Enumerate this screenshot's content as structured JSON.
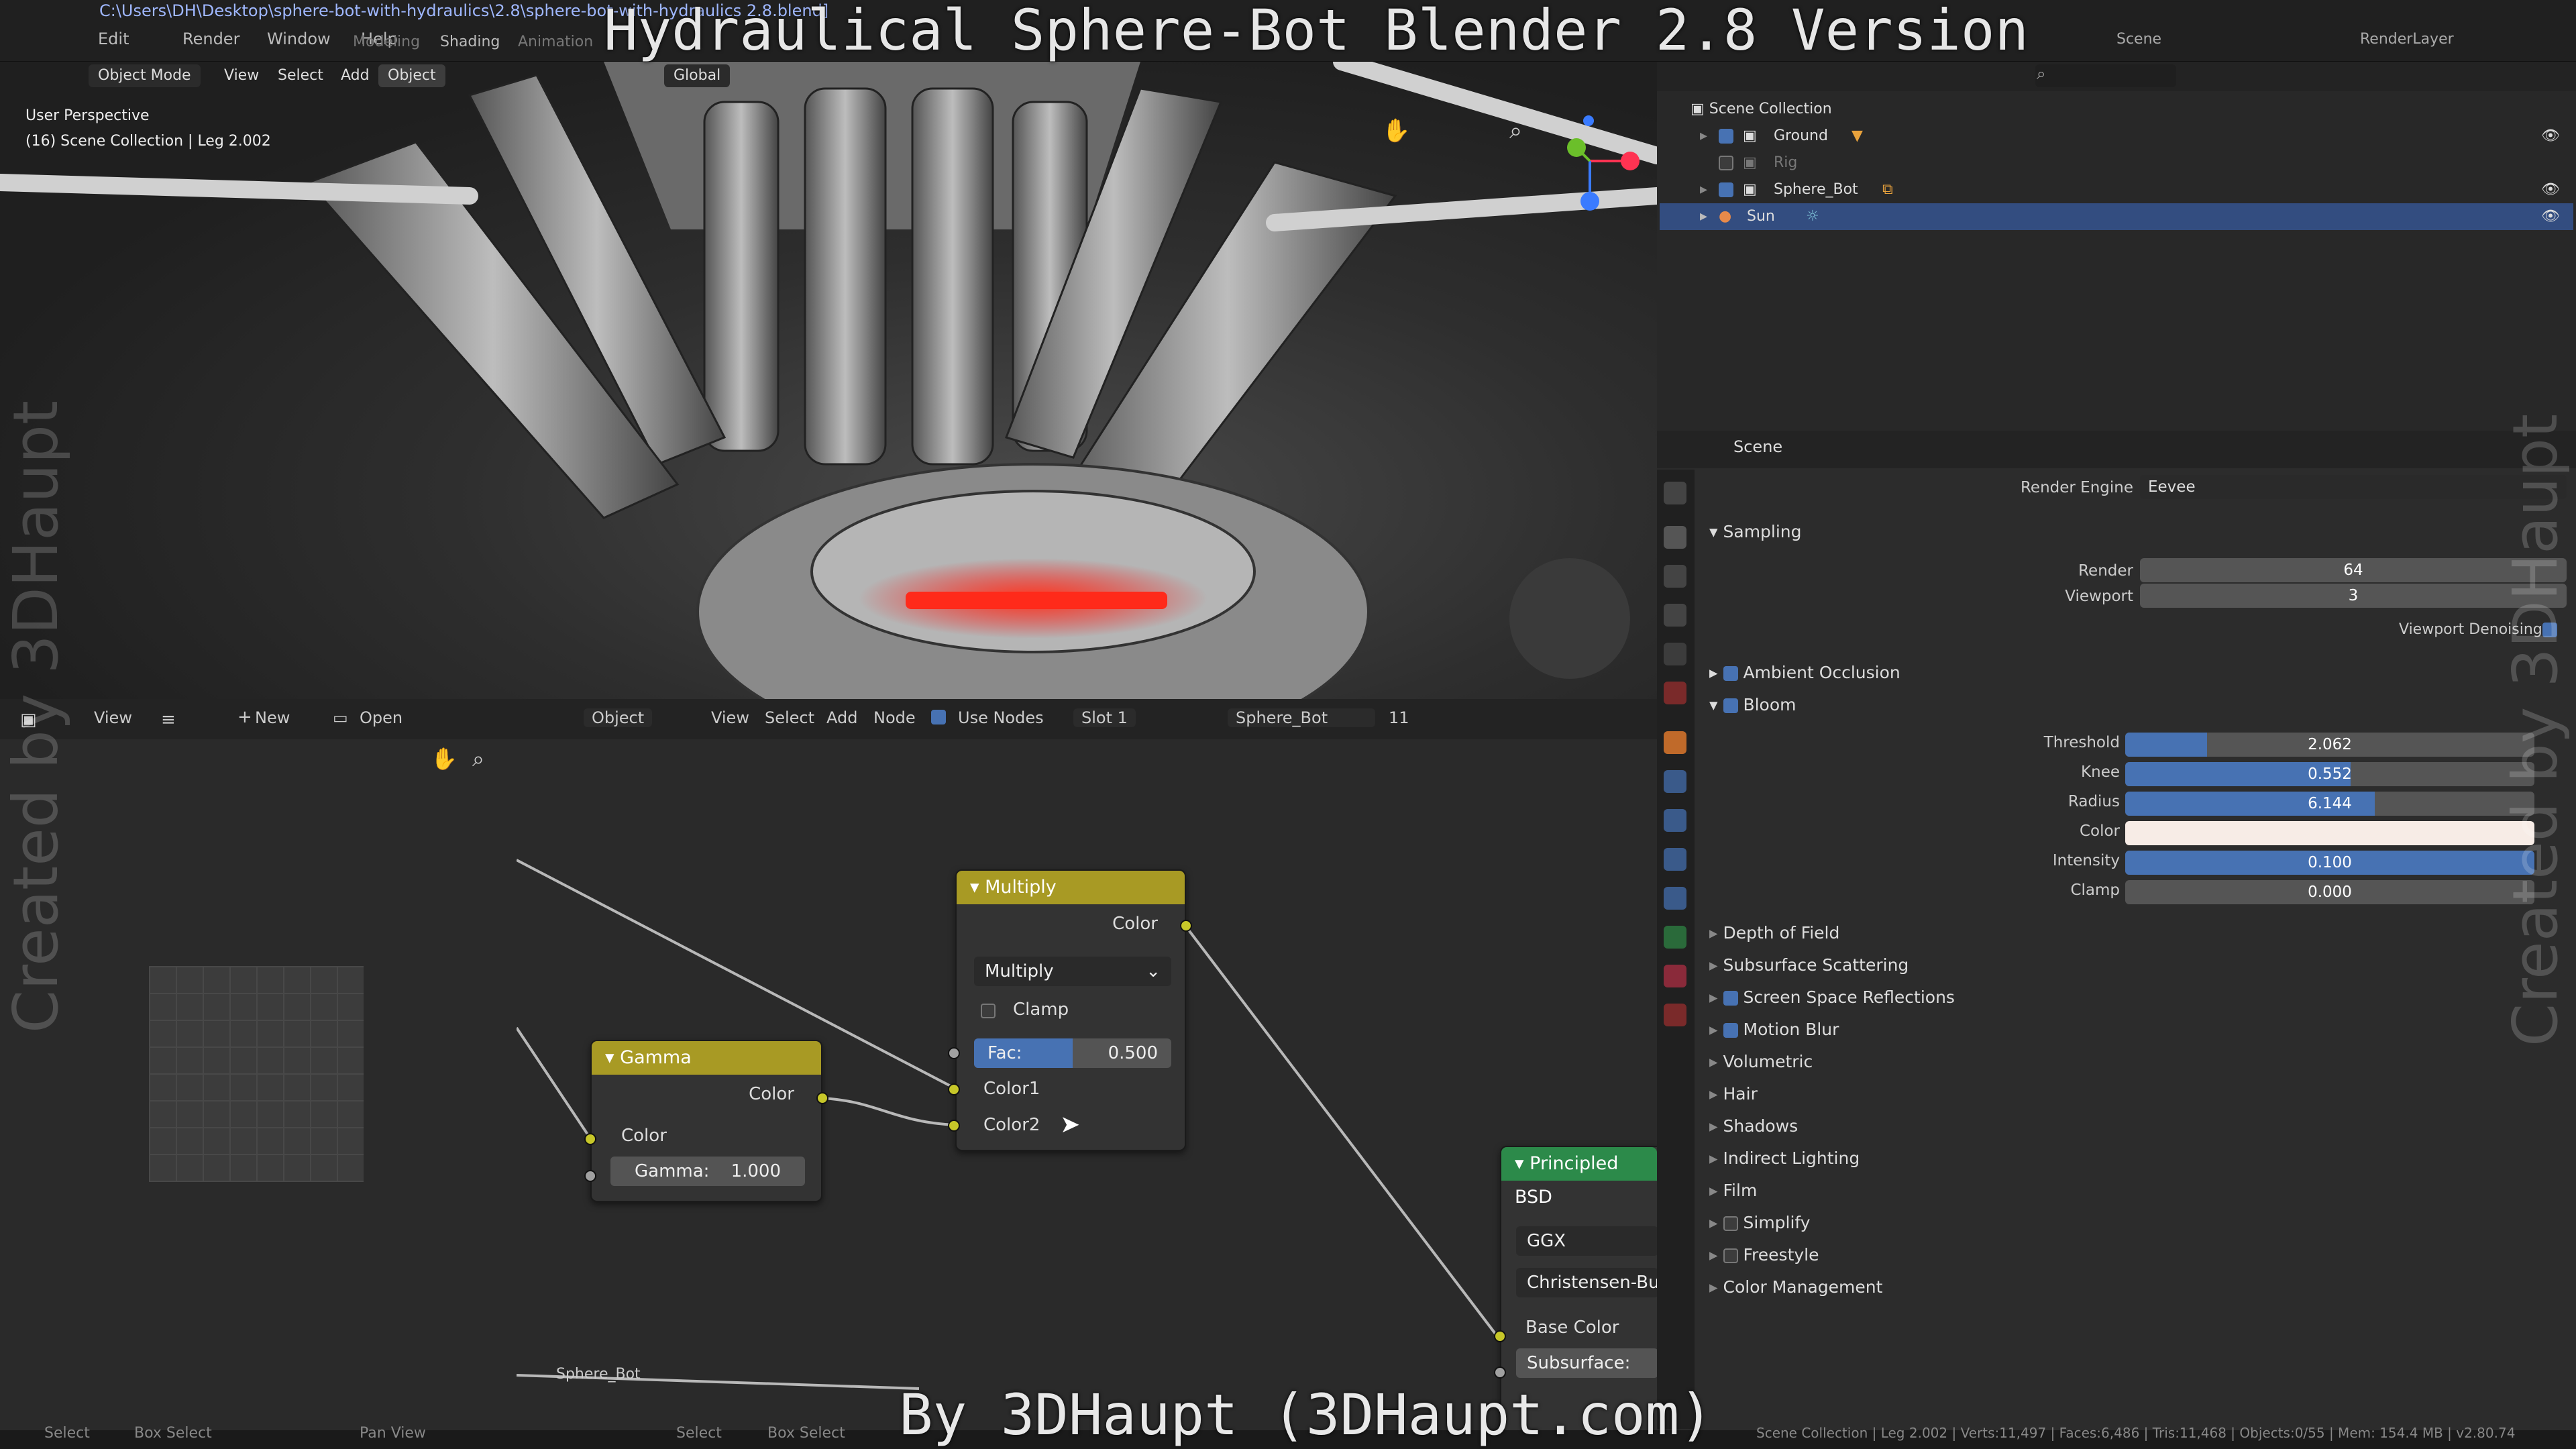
{
  "app": {
    "file_path": "C:\\Users\\DH\\Desktop\\sphere-bot-with-hydraulics\\2.8\\sphere-bot-with-hydraulics 2.8.blend]",
    "menus": [
      "Edit",
      "Render",
      "Window",
      "Help"
    ],
    "workspaces": [
      "Modeling",
      "Shading",
      "Animation"
    ],
    "scene": "Scene",
    "render_layer": "RenderLayer"
  },
  "overlay": {
    "title": "Hydraulical Sphere-Bot Blender 2.8 Version",
    "credit": "By 3DHaupt (3DHaupt.com)",
    "watermark_left": "Created by 3DHaupt",
    "watermark_right": "Created by 3DHaupt"
  },
  "viewport": {
    "mode": "Object Mode",
    "menus": [
      "View",
      "Select",
      "Add",
      "Object"
    ],
    "transform": "Global",
    "info_line1": "User Perspective",
    "info_line2": "(16) Scene Collection | Leg 2.002"
  },
  "image_editor": {
    "view": "View",
    "new": "New",
    "open": "Open"
  },
  "node_editor": {
    "object": "Object",
    "menus": [
      "View",
      "Select",
      "Add",
      "Node"
    ],
    "use_nodes": "Use Nodes",
    "slot": "Slot 1",
    "material": "Sphere_Bot",
    "users": "11",
    "material_label": "Sphere_Bot",
    "multiply": {
      "title": "Multiply",
      "output": "Color",
      "mode": "Multiply",
      "clamp": "Clamp",
      "fac_label": "Fac:",
      "fac_value": "0.500",
      "fac": 0.5,
      "input1": "Color1",
      "input2": "Color2"
    },
    "gamma": {
      "title": "Gamma",
      "output": "Color",
      "input": "Color",
      "gamma_label": "Gamma:",
      "gamma_value": "1.000"
    },
    "principled": {
      "title": "Principled BSD",
      "distribution": "GGX",
      "subsurface_method": "Christensen-Bur",
      "base_color": "Base Color",
      "subsurface": "Subsurface:"
    }
  },
  "outliner": {
    "root": "Scene Collection",
    "items": [
      {
        "name": "Ground",
        "checked": true
      },
      {
        "name": "Rig",
        "checked": false
      },
      {
        "name": "Sphere_Bot",
        "checked": true
      },
      {
        "name": "Sun",
        "checked": true
      }
    ]
  },
  "properties": {
    "context": "Scene",
    "render_engine_label": "Render Engine",
    "render_engine": "Eevee",
    "sampling": {
      "title": "Sampling",
      "render_label": "Render",
      "render": "64",
      "viewport_label": "Viewport",
      "viewport": "3",
      "denoise": "Viewport Denoising"
    },
    "ambient_occlusion": "Ambient Occlusion",
    "bloom": {
      "title": "Bloom",
      "threshold_label": "Threshold",
      "threshold": "2.062",
      "threshold_fill": 0.2,
      "knee_label": "Knee",
      "knee": "0.552",
      "knee_fill": 0.55,
      "radius_label": "Radius",
      "radius": "6.144",
      "radius_fill": 0.61,
      "color_label": "Color",
      "intensity_label": "Intensity",
      "intensity": "0.100",
      "intensity_fill": 1.0,
      "clamp_label": "Clamp",
      "clamp": "0.000",
      "clamp_fill": 0.0
    },
    "panels": [
      {
        "label": "Depth of Field",
        "checkbox": false
      },
      {
        "label": "Subsurface Scattering",
        "checkbox": false
      },
      {
        "label": "Screen Space Reflections",
        "checkbox": true
      },
      {
        "label": "Motion Blur",
        "checkbox": true
      },
      {
        "label": "Volumetric",
        "checkbox": false
      },
      {
        "label": "Hair",
        "checkbox": false
      },
      {
        "label": "Shadows",
        "checkbox": false
      },
      {
        "label": "Indirect Lighting",
        "checkbox": false
      },
      {
        "label": "Film",
        "checkbox": false
      },
      {
        "label": "Simplify",
        "checkbox": "off"
      },
      {
        "label": "Freestyle",
        "checkbox": "off"
      },
      {
        "label": "Color Management",
        "checkbox": false
      }
    ]
  },
  "statusbar": {
    "left": [
      "Select",
      "Box Select",
      "Pan View",
      "Select",
      "Box Select"
    ],
    "right": "Scene Collection | Leg 2.002 | Verts:11,497 | Faces:6,486 | Tris:11,468 | Objects:0/55 | Mem: 154.4 MB | v2.80.74"
  },
  "colors": {
    "accent": "#4772b3",
    "node_header_yellow": "#a89a24",
    "socket_yellow": "#c7c729",
    "principled_green": "#2c8a4a",
    "glow_red": "#ff2a1a"
  }
}
